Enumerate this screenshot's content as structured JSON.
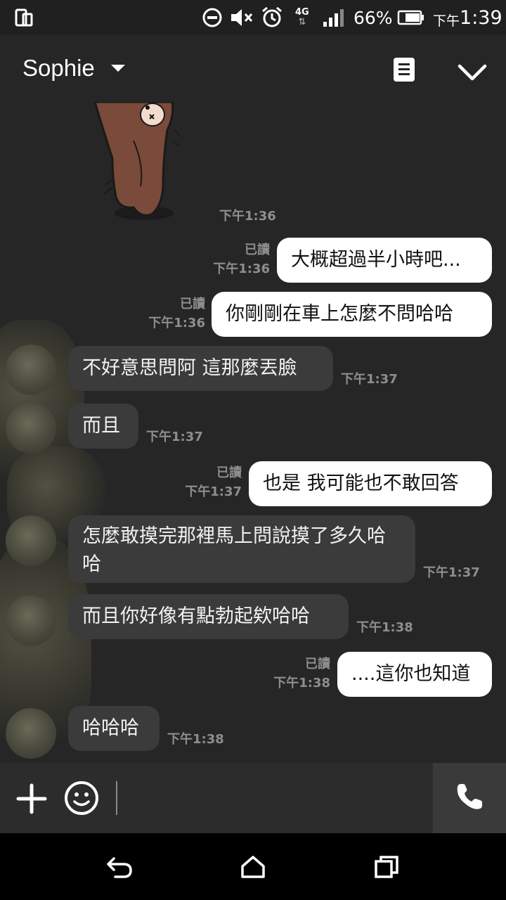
{
  "status_bar": {
    "network": "4G",
    "battery": "66%",
    "time_prefix": "下午",
    "time": "1:39"
  },
  "header": {
    "title": "Sophie"
  },
  "sticker": {
    "time": "下午1:36"
  },
  "messages": [
    {
      "side": "out",
      "text": "大概超過半小時吧...",
      "read": "已讀",
      "time": "下午1:36"
    },
    {
      "side": "out",
      "text": "你剛剛在車上怎麼不問哈哈",
      "read": "已讀",
      "time": "下午1:36"
    },
    {
      "side": "in",
      "text": "不好意思問阿 這那麼丟臉",
      "time": "下午1:37"
    },
    {
      "side": "in",
      "text": "而且",
      "time": "下午1:37"
    },
    {
      "side": "out",
      "text": "也是 我可能也不敢回答",
      "read": "已讀",
      "time": "下午1:37"
    },
    {
      "side": "in",
      "text": "怎麼敢摸完那裡馬上問說摸了多久哈哈",
      "time": "下午1:37"
    },
    {
      "side": "in",
      "text": "而且你好像有點勃起欸哈哈",
      "time": "下午1:38"
    },
    {
      "side": "out",
      "text": "....這你也知道",
      "read": "已讀",
      "time": "下午1:38"
    },
    {
      "side": "in",
      "text": "哈哈哈",
      "time": "下午1:38"
    }
  ],
  "icons": {
    "status": [
      "phone-screen-icon",
      "do-not-disturb-icon",
      "mute-icon",
      "alarm-icon",
      "signal-icon",
      "battery-icon"
    ],
    "header": [
      "notes-icon",
      "chevron-down-icon"
    ],
    "input": [
      "plus-icon",
      "emoji-icon",
      "phone-call-icon"
    ],
    "nav": [
      "back-icon",
      "home-icon",
      "recents-icon"
    ]
  },
  "colors": {
    "background": "#262626",
    "outgoing_bubble": "#ffffff",
    "incoming_bubble": "#3b3b3b",
    "meta_text": "#8e8e8e"
  }
}
